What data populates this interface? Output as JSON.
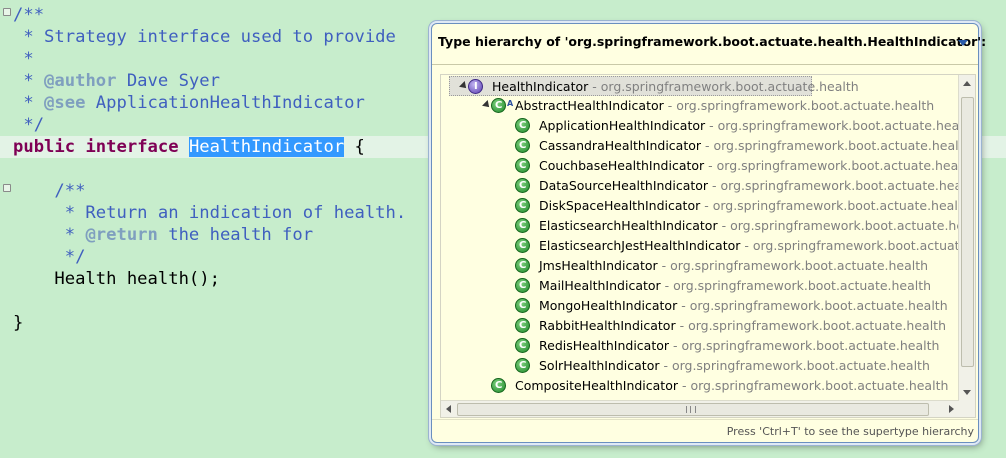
{
  "editor": {
    "lines": [
      {
        "parts": [
          {
            "t": "/**",
            "c": "c"
          }
        ]
      },
      {
        "parts": [
          {
            "t": " * Strategy interface used to provide",
            "c": "c"
          }
        ]
      },
      {
        "parts": [
          {
            "t": " *",
            "c": "c"
          }
        ]
      },
      {
        "parts": [
          {
            "t": " * ",
            "c": "c"
          },
          {
            "t": "@author",
            "c": "tag"
          },
          {
            "t": " Dave Syer",
            "c": "c"
          }
        ]
      },
      {
        "parts": [
          {
            "t": " * ",
            "c": "c"
          },
          {
            "t": "@see",
            "c": "tag"
          },
          {
            "t": " ApplicationHealthIndicator",
            "c": "c"
          }
        ]
      },
      {
        "parts": [
          {
            "t": " */",
            "c": "c"
          }
        ]
      },
      {
        "parts": [
          {
            "t": "public",
            "c": "kw"
          },
          {
            "t": " "
          },
          {
            "t": "interface",
            "c": "kw"
          },
          {
            "t": " "
          },
          {
            "t": "HealthIndicator",
            "c": "sel"
          },
          {
            "t": " {"
          }
        ]
      },
      {
        "parts": [
          {
            "t": ""
          }
        ]
      },
      {
        "parts": [
          {
            "t": "    /**",
            "c": "c"
          }
        ]
      },
      {
        "parts": [
          {
            "t": "     * Return an indication of health.",
            "c": "c"
          }
        ]
      },
      {
        "parts": [
          {
            "t": "     * ",
            "c": "c"
          },
          {
            "t": "@return",
            "c": "tag"
          },
          {
            "t": " the health for",
            "c": "c"
          }
        ]
      },
      {
        "parts": [
          {
            "t": "     */",
            "c": "c"
          }
        ]
      },
      {
        "parts": [
          {
            "t": "    Health health();"
          }
        ]
      },
      {
        "parts": [
          {
            "t": ""
          }
        ]
      },
      {
        "parts": [
          {
            "t": "}"
          }
        ]
      }
    ]
  },
  "popup": {
    "title": "Type hierarchy of 'org.springframework.boot.actuate.health.HealthIndicator':",
    "status": "Press 'Ctrl+T' to see the supertype hierarchy",
    "tree": [
      {
        "name": "HealthIndicator",
        "pkg": " - org.springframework.boot.actuate.health",
        "kind": "iface",
        "level": 0,
        "expanded": true,
        "selected": true
      },
      {
        "name": "AbstractHealthIndicator",
        "pkg": " - org.springframework.boot.actuate.health",
        "kind": "class",
        "abstract": true,
        "level": 1,
        "expanded": true
      },
      {
        "name": "ApplicationHealthIndicator",
        "pkg": " - org.springframework.boot.actuate.health",
        "kind": "class",
        "level": 2
      },
      {
        "name": "CassandraHealthIndicator",
        "pkg": " - org.springframework.boot.actuate.health",
        "kind": "class",
        "level": 2
      },
      {
        "name": "CouchbaseHealthIndicator",
        "pkg": " - org.springframework.boot.actuate.health",
        "kind": "class",
        "level": 2
      },
      {
        "name": "DataSourceHealthIndicator",
        "pkg": " - org.springframework.boot.actuate.health",
        "kind": "class",
        "level": 2
      },
      {
        "name": "DiskSpaceHealthIndicator",
        "pkg": " - org.springframework.boot.actuate.health",
        "kind": "class",
        "level": 2
      },
      {
        "name": "ElasticsearchHealthIndicator",
        "pkg": " - org.springframework.boot.actuate.health",
        "kind": "class",
        "level": 2
      },
      {
        "name": "ElasticsearchJestHealthIndicator",
        "pkg": " - org.springframework.boot.actuate.he",
        "kind": "class",
        "level": 2
      },
      {
        "name": "JmsHealthIndicator",
        "pkg": " - org.springframework.boot.actuate.health",
        "kind": "class",
        "level": 2
      },
      {
        "name": "MailHealthIndicator",
        "pkg": " - org.springframework.boot.actuate.health",
        "kind": "class",
        "level": 2
      },
      {
        "name": "MongoHealthIndicator",
        "pkg": " - org.springframework.boot.actuate.health",
        "kind": "class",
        "level": 2
      },
      {
        "name": "RabbitHealthIndicator",
        "pkg": " - org.springframework.boot.actuate.health",
        "kind": "class",
        "level": 2
      },
      {
        "name": "RedisHealthIndicator",
        "pkg": " - org.springframework.boot.actuate.health",
        "kind": "class",
        "level": 2
      },
      {
        "name": "SolrHealthIndicator",
        "pkg": " - org.springframework.boot.actuate.health",
        "kind": "class",
        "level": 2
      },
      {
        "name": "CompositeHealthIndicator",
        "pkg": " - org.springframework.boot.actuate.health",
        "kind": "class",
        "level": 1
      }
    ]
  },
  "colors": {
    "editor_bg": "#c7edcc",
    "popup_bg": "#ffffe1",
    "selection": "#3399ff",
    "keyword": "#7f0055",
    "comment": "#3f5fbf",
    "package_text": "#808080"
  },
  "icons": {
    "class": "class-icon",
    "interface": "interface-icon",
    "menu": "view-menu-icon"
  }
}
